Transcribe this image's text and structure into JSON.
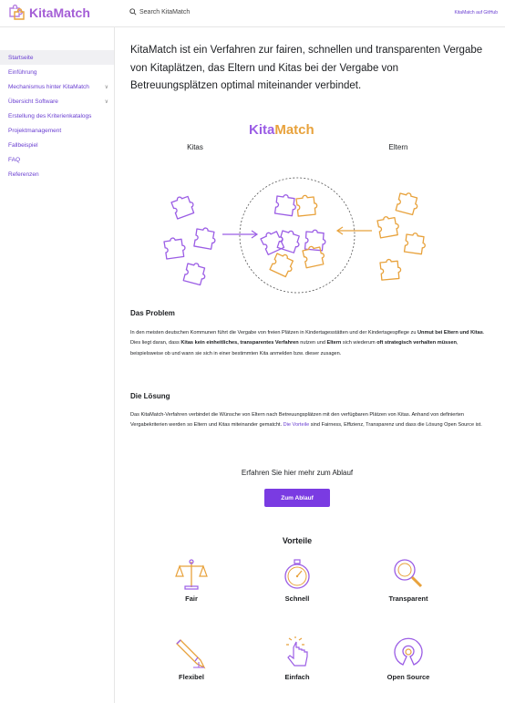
{
  "header": {
    "logo_text": "KitaMatch",
    "search_label": "Search KitaMatch",
    "github_link": "KitaMatch auf GitHub"
  },
  "sidebar": {
    "items": [
      {
        "label": "Startseite",
        "active": true,
        "expandable": false
      },
      {
        "label": "Einführung",
        "active": false,
        "expandable": false
      },
      {
        "label": "Mechanismus hinter KitaMatch",
        "active": false,
        "expandable": true
      },
      {
        "label": "Übersicht Software",
        "active": false,
        "expandable": true
      },
      {
        "label": "Erstellung des Kriterienkatalogs",
        "active": false,
        "expandable": false
      },
      {
        "label": "Projektmanagement",
        "active": false,
        "expandable": false
      },
      {
        "label": "Fallbeispiel",
        "active": false,
        "expandable": false
      },
      {
        "label": "FAQ",
        "active": false,
        "expandable": false
      },
      {
        "label": "Referenzen",
        "active": false,
        "expandable": false
      }
    ]
  },
  "main": {
    "intro": "KitaMatch ist ein Verfahren zur fairen, schnellen und transparenten Vergabe von Kitaplätzen, das Eltern und Kitas bei der Vergabe von Betreuungsplätzen optimal miteinander verbindet.",
    "illustration": {
      "title_kita": "Kita",
      "title_match": "Match",
      "left_label": "Kitas",
      "right_label": "Eltern"
    },
    "problem": {
      "heading": "Das Problem",
      "text_1": "In den meisten deutschen Kommunen führt die Vergabe von freien Plätzen in Kindertagesstätten und der Kindertagespflege zu ",
      "bold_1": "Unmut bei Eltern und Kitas",
      "text_2": ". Dies liegt daran, dass ",
      "bold_2": "Kitas kein einheitliches, transparentes Verfahren",
      "text_3": " nutzen und ",
      "bold_3": "Eltern",
      "text_4": " sich wiederum ",
      "bold_4": "oft strategisch verhalten müssen",
      "text_5": ", beispielsweise ob und wann sie sich in einer bestimmten Kita anmelden bzw. dieser zusagen."
    },
    "solution": {
      "heading": "Die Lösung",
      "text_1": "Das KitaMatch-Verfahren verbindet die Wünsche von Eltern nach Betreuungsplätzen mit den verfügbaren Plätzen von Kitas. Anhand von definierten Vergabekriterien werden so Eltern und Kitas miteinander gematcht. ",
      "link": "Die Vorteile",
      "text_2": " sind Fairness, Effizienz, Transparenz und dass die Lösung Open Source ist."
    },
    "cta": {
      "heading": "Erfahren Sie hier mehr zum Ablauf",
      "button": "Zum Ablauf"
    },
    "vorteile": {
      "title": "Vorteile",
      "items": [
        {
          "label": "Fair",
          "icon": "scale-icon"
        },
        {
          "label": "Schnell",
          "icon": "stopwatch-icon"
        },
        {
          "label": "Transparent",
          "icon": "magnifier-icon"
        },
        {
          "label": "Flexibel",
          "icon": "pencil-icon"
        },
        {
          "label": "Einfach",
          "icon": "hand-click-icon"
        },
        {
          "label": "Open Source",
          "icon": "open-source-icon"
        }
      ]
    }
  },
  "colors": {
    "accent": "#7a3be2",
    "purple": "#9b5de5",
    "orange": "#e8a23c",
    "link": "#6a3fd1"
  }
}
